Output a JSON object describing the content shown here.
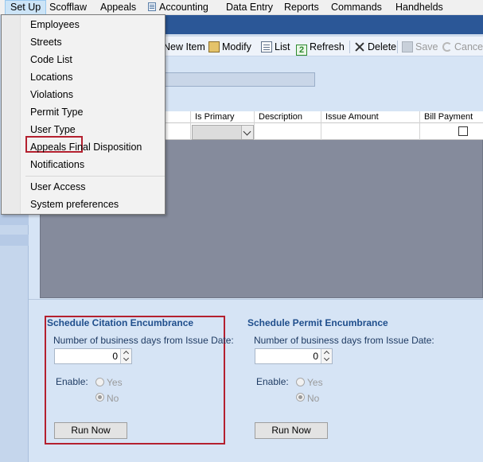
{
  "menubar": {
    "items": [
      {
        "label": "Set Up"
      },
      {
        "label": "Scofflaw"
      },
      {
        "label": "Appeals"
      },
      {
        "label": "Accounting"
      },
      {
        "label": "Data Entry"
      },
      {
        "label": "Reports"
      },
      {
        "label": "Commands"
      },
      {
        "label": "Handhelds"
      }
    ]
  },
  "setup_menu": {
    "items": [
      {
        "label": "Employees"
      },
      {
        "label": "Streets"
      },
      {
        "label": "Code List"
      },
      {
        "label": "Locations"
      },
      {
        "label": "Violations"
      },
      {
        "label": "Permit Type"
      },
      {
        "label": "User Type"
      },
      {
        "label": "Appeals Final Disposition"
      },
      {
        "label": "Notifications"
      },
      {
        "label": "User Access"
      },
      {
        "label": "System preferences"
      }
    ],
    "highlighted": "User Type"
  },
  "toolbar": {
    "new_item": "New Item",
    "modify": "Modify",
    "list": "List",
    "refresh": "Refresh",
    "delete": "Delete",
    "save": "Save",
    "cancel": "Cance"
  },
  "grid": {
    "columns": [
      "Is Primary",
      "Description",
      "Issue Amount",
      "Bill Payment"
    ]
  },
  "citation_encumbrance": {
    "title": "Schedule Citation Encumbrance",
    "days_label": "Number of business days from Issue Date:",
    "days_value": "0",
    "enable_label": "Enable:",
    "yes_label": "Yes",
    "no_label": "No",
    "run_now": "Run Now"
  },
  "permit_encumbrance": {
    "title": "Schedule Permit Encumbrance",
    "days_label": "Number of business days from Issue Date:",
    "days_value": "0",
    "enable_label": "Enable:",
    "yes_label": "Yes",
    "no_label": "No",
    "run_now": "Run Now"
  },
  "colors": {
    "highlight_border": "#b4202f",
    "title_bar": "#2b5797",
    "section_title": "#1f4e8c"
  }
}
